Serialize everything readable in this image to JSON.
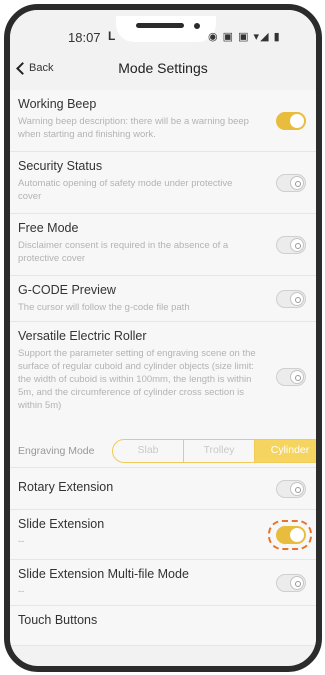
{
  "status_bar": {
    "time": "18:07",
    "carrier_glyph": "L",
    "icons": "◉ ▣ ▣ ▾◢ ▮"
  },
  "nav": {
    "back_label": "Back",
    "title": "Mode Settings"
  },
  "settings": [
    {
      "title": "Working Beep",
      "desc": "Warning beep description: there will be a warning beep when starting and finishing work.",
      "on": true
    },
    {
      "title": "Security Status",
      "desc": "Automatic opening of safety mode under protective cover",
      "on": false
    },
    {
      "title": "Free Mode",
      "desc": "Disclaimer consent is required in the absence of a protective cover",
      "on": false
    },
    {
      "title": "G-CODE Preview",
      "desc": "The cursor will follow the g-code file path",
      "on": false
    },
    {
      "title": "Versatile Electric Roller",
      "desc": "Support the parameter setting of engraving scene on the surface of regular cuboid and cylinder objects (size limit: the width of cuboid is within 100mm, the length is within 5m, and the circumference of cylinder cross section is within 5m)",
      "on": false
    },
    {
      "title": "Rotary Extension",
      "desc": "--",
      "on": false
    },
    {
      "title": "Slide Extension",
      "desc": "--",
      "on": true
    },
    {
      "title": "Slide Extension Multi-file Mode",
      "desc": "--",
      "on": false
    },
    {
      "title": "Touch Buttons",
      "desc": "",
      "on": false
    }
  ],
  "engraving_mode": {
    "label": "Engraving Mode",
    "options": [
      "Slab",
      "Trolley",
      "Cylinder"
    ],
    "selected": "Cylinder"
  },
  "colors": {
    "accent": "#e8bd3d",
    "highlight_outline": "#e8742a"
  }
}
